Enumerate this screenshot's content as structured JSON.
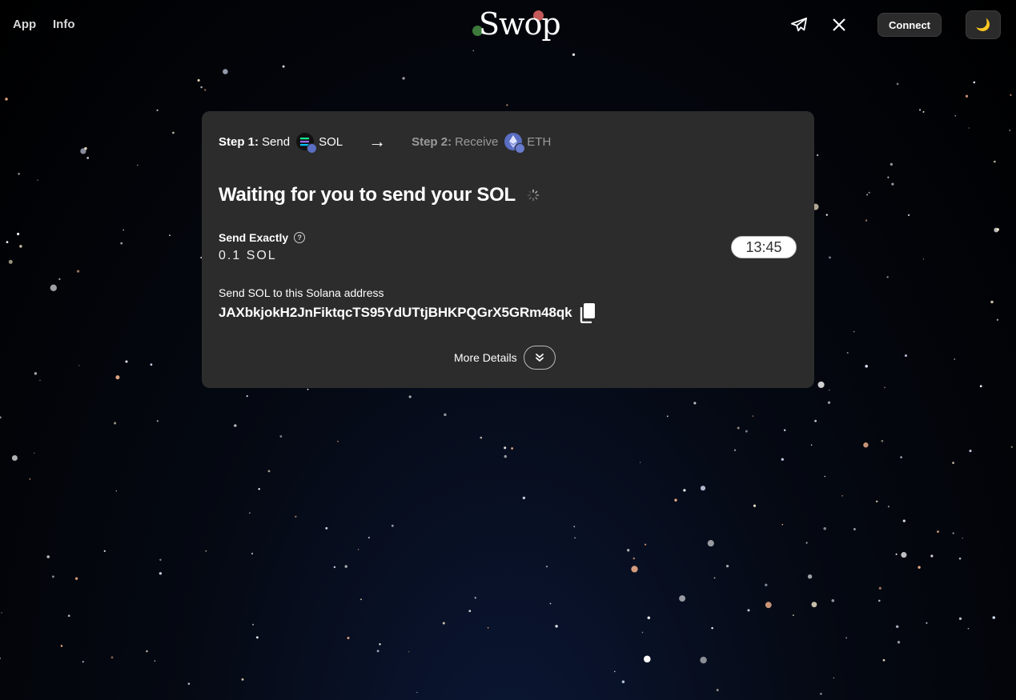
{
  "nav": {
    "app_label": "App",
    "info_label": "Info"
  },
  "logo": {
    "text": "Swop"
  },
  "header_actions": {
    "telegram_icon": "telegram-icon",
    "x_icon": "x-twitter-icon",
    "connect_label": "Connect",
    "theme_icon": "🌙"
  },
  "steps": {
    "step1_prefix": "Step 1:",
    "step1_action": "Send",
    "step1_coin": "SOL",
    "arrow": "→",
    "step2_prefix": "Step 2:",
    "step2_action": "Receive",
    "step2_coin": "ETH"
  },
  "status": {
    "title": "Waiting for you to send your SOL"
  },
  "send": {
    "label": "Send Exactly",
    "help": "?",
    "amount": "0.1 SOL",
    "timer": "13:45"
  },
  "address": {
    "label": "Send SOL to this Solana address",
    "value": "JAXbkjokH2JnFiktqcTS95YdUTtjBHKPQGrX5GRm48qk"
  },
  "details": {
    "label": "More Details"
  },
  "colors": {
    "card_bg": "#2c2c2c",
    "page_bg": "#000000",
    "sol_coin": "#111111",
    "eth_coin": "#5a6ec2"
  }
}
